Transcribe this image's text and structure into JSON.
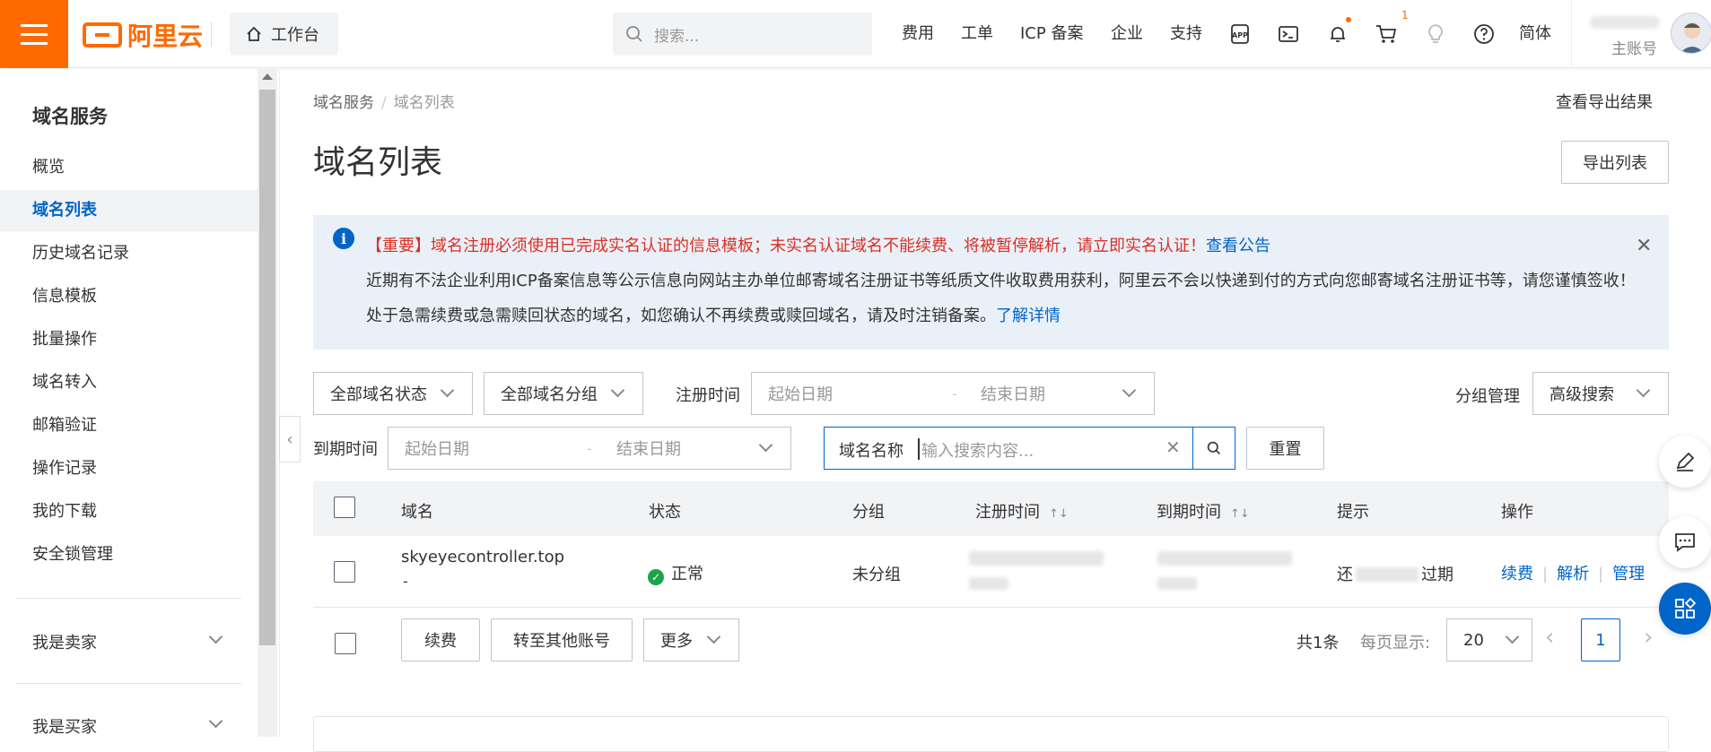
{
  "topbar": {
    "logo_text": "阿里云",
    "workbench_label": "工作台",
    "search_placeholder": "搜索...",
    "nav": [
      "费用",
      "工单",
      "ICP 备案",
      "企业",
      "支持"
    ],
    "cart_count": "1",
    "lang": "简体",
    "account_label": "主账号"
  },
  "sidebar": {
    "title": "域名服务",
    "items": [
      "概览",
      "域名列表",
      "历史域名记录",
      "信息模板",
      "批量操作",
      "域名转入",
      "邮箱验证",
      "操作记录",
      "我的下载",
      "安全锁管理"
    ],
    "active_index": 1,
    "groups": [
      "我是卖家",
      "我是买家"
    ]
  },
  "breadcrumb": {
    "root": "域名服务",
    "sep": "/",
    "current": "域名列表"
  },
  "header": {
    "view_export": "查看导出结果",
    "title": "域名列表",
    "export_button": "导出列表"
  },
  "alert": {
    "line1_red": "【重要】域名注册必须使用已完成实名认证的信息模板；未实名认证域名不能续费、将被暂停解析，请立即实名认证！",
    "line1_link": "查看公告",
    "line2": "近期有不法企业利用ICP备案信息等公示信息向网站主办单位邮寄域名注册证书等纸质文件收取费用获利，阿里云不会以快递到付的方式向您邮寄域名注册证书等，请您谨慎签收！",
    "line3": "处于急需续费或急需赎回状态的域名，如您确认不再续费或赎回域名，请及时注销备案。",
    "line3_link": "了解详情"
  },
  "filters": {
    "status": "全部域名状态",
    "group": "全部域名分组",
    "reg_label": "注册时间",
    "start_ph": "起始日期",
    "end_ph": "结束日期",
    "dash": "-",
    "group_mgmt": "分组管理",
    "advanced": "高级搜索",
    "exp_label": "到期时间",
    "search_field": "域名名称",
    "search_ph": "输入搜索内容...",
    "reset": "重置"
  },
  "table": {
    "headers": [
      "域名",
      "状态",
      "分组",
      "注册时间",
      "到期时间",
      "提示",
      "操作"
    ],
    "rows": [
      {
        "domain": "skyeyecontroller.top",
        "sub": "-",
        "status": "正常",
        "group": "未分组",
        "hint_prefix": "还",
        "hint_suffix": "过期",
        "ops": [
          "续费",
          "解析",
          "管理"
        ]
      }
    ]
  },
  "footer": {
    "renew": "续费",
    "transfer": "转至其他账号",
    "more": "更多",
    "total": "共1条",
    "per_page_label": "每页显示:",
    "per_page": "20",
    "page": "1"
  },
  "colors": {
    "brand": "#ff6a00",
    "link": "#0064c8",
    "alert_red": "#d93026",
    "success": "#1aa44a"
  }
}
